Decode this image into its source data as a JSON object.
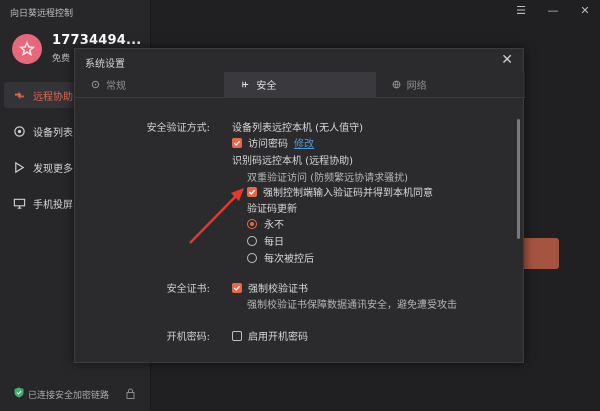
{
  "app": {
    "title": "向日葵远程控制"
  },
  "user": {
    "id": "17734494...",
    "plan": "免费"
  },
  "nav": [
    {
      "label": "远程协助",
      "icon": "remote-assist-icon",
      "active": true
    },
    {
      "label": "设备列表",
      "icon": "device-list-icon",
      "active": false
    },
    {
      "label": "发现更多",
      "icon": "discover-icon",
      "active": false
    },
    {
      "label": "手机投屏",
      "icon": "screen-cast-icon",
      "active": false
    }
  ],
  "footer": {
    "secure_text": "已连接安全加密链路"
  },
  "colors": {
    "accent": "#e8674a",
    "link": "#4f9ad6"
  },
  "dialog": {
    "title": "系统设置",
    "tabs": [
      {
        "label": "常规",
        "icon": "gear-icon",
        "active": false
      },
      {
        "label": "安全",
        "icon": "shield-icon",
        "active": true
      },
      {
        "label": "网络",
        "icon": "globe-icon",
        "active": false
      }
    ],
    "security": {
      "verify_label": "安全验证方式:",
      "device_list_heading": "设备列表远控本机 (无人值守)",
      "access_password": "访问密码",
      "modify_link": "修改",
      "code_heading": "识别码远控本机 (远程协助)",
      "double_verify": "双重验证访问 (防频繁远协请求骚扰)",
      "force_code": "强制控制端输入验证码并得到本机同意",
      "code_update_heading": "验证码更新",
      "options": [
        "永不",
        "每日",
        "每次被控后"
      ],
      "cert_label": "安全证书:",
      "cert_check": "强制校验证书",
      "cert_desc": "强制校验证书保障数据通讯安全，避免遭受攻击",
      "boot_label": "开机密码:",
      "boot_check": "启用开机密码"
    }
  }
}
